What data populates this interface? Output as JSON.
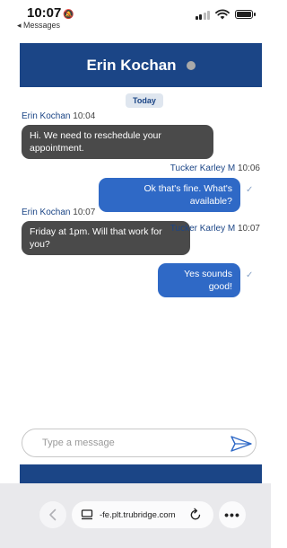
{
  "status_bar": {
    "time": "10:07",
    "back_app": "◂ Messages"
  },
  "chat": {
    "title": "Erin Kochan",
    "presence": "offline",
    "date_separator": "Today",
    "messages": [
      {
        "direction": "in",
        "sender": "Erin Kochan",
        "time": "10:04",
        "text": "Hi. We need to reschedule your appointment."
      },
      {
        "direction": "out",
        "sender": "Tucker Karley M",
        "time": "10:06",
        "text": "Ok that's fine. What's available?"
      },
      {
        "direction": "in",
        "sender": "Erin Kochan",
        "time": "10:07",
        "text": "Friday at 1pm. Will that work for you?"
      },
      {
        "direction": "out",
        "sender": "Tucker Karley M",
        "time": "10:07",
        "text": "Yes sounds good!"
      }
    ],
    "input": {
      "placeholder": "Type a message",
      "value": ""
    }
  },
  "browser": {
    "url": "-fe.plt.trubridge.com",
    "more_label": "•••"
  },
  "colors": {
    "header_blue": "#1b4586",
    "outgoing_bubble": "#2f69c6",
    "incoming_bubble": "#4a4a4a"
  },
  "icons": [
    "bell-silenced-icon",
    "signal-icon",
    "wifi-icon",
    "battery-icon",
    "presence-dot",
    "read-check-icon",
    "send-icon",
    "back-chevron-icon",
    "page-icon",
    "reload-icon",
    "more-icon"
  ]
}
